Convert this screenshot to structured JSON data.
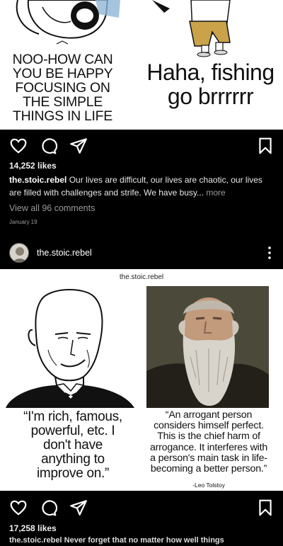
{
  "post1": {
    "meme_left_lines": [
      "NOO-HOW CAN",
      "YOU BE HAPPY",
      "FOCUSING ON",
      "THE SIMPLE",
      "THINGS IN LIFE"
    ],
    "meme_right_lines": [
      "Haha, fishing",
      "go brrrrrr"
    ],
    "likes": "14,252 likes",
    "username": "the.stoic.rebel",
    "caption_text": "Our lives are difficult, our lives are chaotic, our lives are filled with challenges and strife. We have busy",
    "caption_more_ellipsis": "...",
    "caption_more": "more",
    "comments_link": "View all 96 comments",
    "date": "January 19"
  },
  "post2": {
    "username": "the.stoic.rebel",
    "meme_handle": "the.stoic.rebel",
    "meme_left_lines": [
      "“I'm rich, famous,",
      "powerful, etc. I",
      "don't have",
      "anything to",
      "improve on.”"
    ],
    "meme_right_lines": [
      "“An arrogant person",
      "considers himself perfect.",
      "This is the chief harm of",
      "arrogance. It interferes with",
      "a person's main task in life-",
      "becoming a better person.”"
    ],
    "meme_attribution": "-Leo Tolstoy",
    "likes": "17,258 likes",
    "caption_cut": "the.stoic.rebel Never forget that no matter how well things"
  },
  "icons": [
    "heart-icon",
    "comment-icon",
    "share-icon",
    "bookmark-icon",
    "more-options-icon"
  ],
  "colors": {
    "background": "#000000",
    "text": "#ffffff",
    "muted": "#9a9a9a"
  }
}
